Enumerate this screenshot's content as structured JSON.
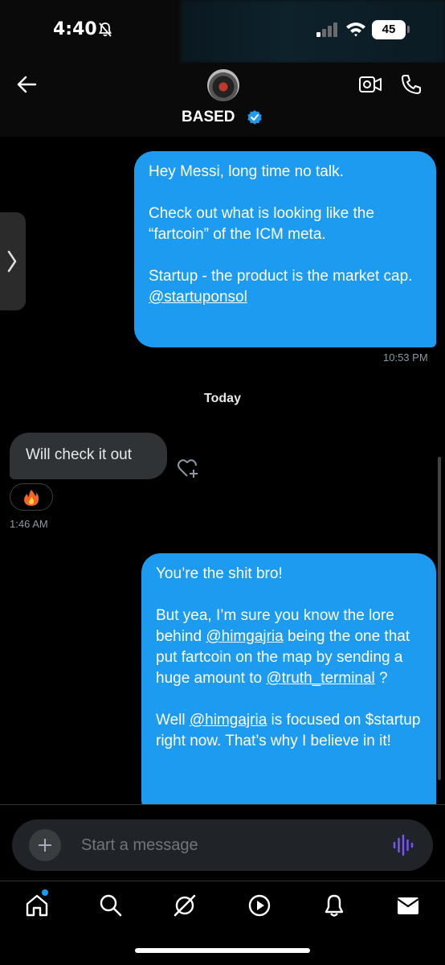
{
  "status_bar": {
    "time": "4:40",
    "battery": "45"
  },
  "header": {
    "contact_name": "BASED"
  },
  "messages": [
    {
      "sender": "me",
      "text": "Hey Messi, long time no talk.\n\nCheck out what is looking like the “fartcoin” of the ICM meta.\n\nStartup - the product is the market cap.",
      "mention": "@startuponsol",
      "time": "10:53 PM"
    },
    {
      "sender": "them",
      "text": "Will check it out",
      "reaction": "🔥",
      "time": "1:46 AM"
    }
  ],
  "day_separator": "Today",
  "last_message": {
    "line1": "You’re the shit bro!",
    "p2_a": "But yea, I’m sure you know the lore behind ",
    "mention_1": "@himgajria",
    "p2_b": " being the one that  put fartcoin on the map by sending a huge amount to ",
    "mention_2": "@truth_terminal",
    "p2_c": " ?",
    "p3_a": "Well ",
    "mention_3": "@himgajria",
    "p3_b": " is focused on $startup right now. That’s why I believe in it!"
  },
  "composer": {
    "placeholder": "Start a message"
  },
  "tabs": [
    {
      "icon": "home-icon"
    },
    {
      "icon": "search-icon"
    },
    {
      "icon": "grok-icon"
    },
    {
      "icon": "video-play-icon"
    },
    {
      "icon": "notifications-icon"
    },
    {
      "icon": "messages-icon"
    }
  ],
  "colors": {
    "bubble_out": "#1d9bf0",
    "bubble_in": "#2f3336",
    "background": "#000000",
    "voice_accent": "#7856ff"
  }
}
